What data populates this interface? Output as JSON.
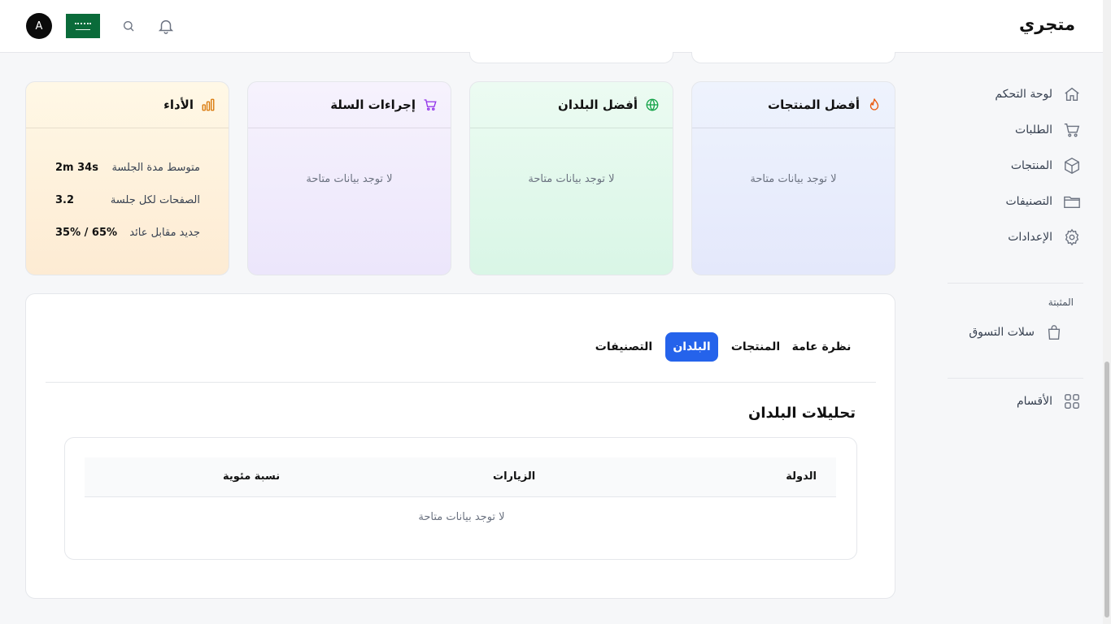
{
  "header": {
    "brand": "متجري",
    "avatar_letter": "A",
    "icons": [
      "search-icon",
      "bell-icon",
      "saudi-flag-icon"
    ]
  },
  "sidebar": {
    "items": [
      {
        "label": "لوحة التحكم",
        "icon": "home-icon"
      },
      {
        "label": "الطلبات",
        "icon": "cart-icon"
      },
      {
        "label": "المنتجات",
        "icon": "box-icon"
      },
      {
        "label": "التصنيفات",
        "icon": "folder-icon"
      },
      {
        "label": "الإعدادات",
        "icon": "gear-icon"
      }
    ],
    "pinned_label": "المثبتة",
    "pinned_items": [
      {
        "label": "سلات التسوق",
        "icon": "shopping-bag-icon"
      }
    ],
    "sections_item": {
      "label": "الأقسام",
      "icon": "grid-icon"
    }
  },
  "cards": {
    "top_products": {
      "title": "أفضل المنتجات",
      "empty": "لا توجد بيانات متاحة",
      "icon": "flame-icon",
      "color": "#ea580c"
    },
    "top_countries": {
      "title": "أفضل البلدان",
      "empty": "لا توجد بيانات متاحة",
      "icon": "globe-icon",
      "color": "#16a34a"
    },
    "cart_actions": {
      "title": "إجراءات السلة",
      "empty": "لا توجد بيانات متاحة",
      "icon": "cart-icon",
      "color": "#9333ea"
    },
    "performance": {
      "title": "الأداء",
      "icon": "bar-chart-icon",
      "color": "#d97706",
      "metrics": [
        {
          "label": "متوسط مدة الجلسة",
          "value": "2m 34s"
        },
        {
          "label": "الصفحات لكل جلسة",
          "value": "3.2"
        },
        {
          "label": "جديد مقابل عائد",
          "value": "35% / 65%"
        }
      ]
    }
  },
  "tabs": [
    {
      "label": "نظرة عامة",
      "active": false
    },
    {
      "label": "المنتجات",
      "active": false
    },
    {
      "label": "البلدان",
      "active": true
    },
    {
      "label": "التصنيفات",
      "active": false
    }
  ],
  "countries_section": {
    "title": "تحليلات البلدان",
    "columns": [
      "الدولة",
      "الزيارات",
      "نسبة مئوية"
    ],
    "empty": "لا توجد بيانات متاحة"
  },
  "colors": {
    "accent": "#2563eb"
  }
}
